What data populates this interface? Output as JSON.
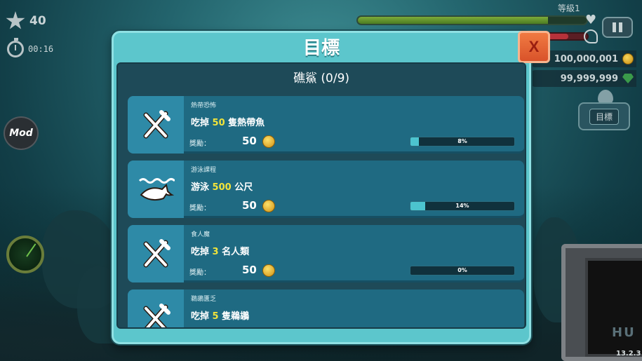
{
  "hud": {
    "stars": "40",
    "timer": "00:16",
    "mod_label": "Mod",
    "level_label": "等級1",
    "coins": "100,000,001",
    "gems": "99,999,999",
    "goals_button_label": "目標",
    "version": "13.2.3",
    "health_fraction": 0.83,
    "growth_fraction": 0.7
  },
  "modal": {
    "title": "目標",
    "close_label": "X",
    "shark_name": "礁鯊 (0/9)"
  },
  "missions": [
    {
      "category": "熱帶恐怖",
      "desc_prefix": "吃掉",
      "desc_value": "50",
      "desc_suffix": "隻熱帶魚",
      "reward_label": "獎勵：",
      "reward_value": "50",
      "progress_text": "8%",
      "progress": 0.08,
      "icon": "fork-knife-icon"
    },
    {
      "category": "游泳課程",
      "desc_prefix": "游泳",
      "desc_value": "500",
      "desc_suffix": "公尺",
      "reward_label": "獎勵：",
      "reward_value": "50",
      "progress_text": "14%",
      "progress": 0.14,
      "icon": "shark-wave-icon"
    },
    {
      "category": "食人魔",
      "desc_prefix": "吃掉",
      "desc_value": "3",
      "desc_suffix": "名人類",
      "reward_label": "獎勵：",
      "reward_value": "50",
      "progress_text": "0%",
      "progress": 0.0,
      "icon": "fork-knife-icon"
    },
    {
      "category": "鵜鶘匱乏",
      "desc_prefix": "吃掉",
      "desc_value": "5",
      "desc_suffix": "隻鵜鶘",
      "reward_label": "",
      "reward_value": "",
      "progress_text": "",
      "progress": 0.0,
      "icon": "fork-knife-icon"
    }
  ],
  "colors": {
    "highlight": "#f2e43a",
    "modal_frame": "#5cc6cc",
    "card": "#1f6a82",
    "close": "#d9532a"
  }
}
